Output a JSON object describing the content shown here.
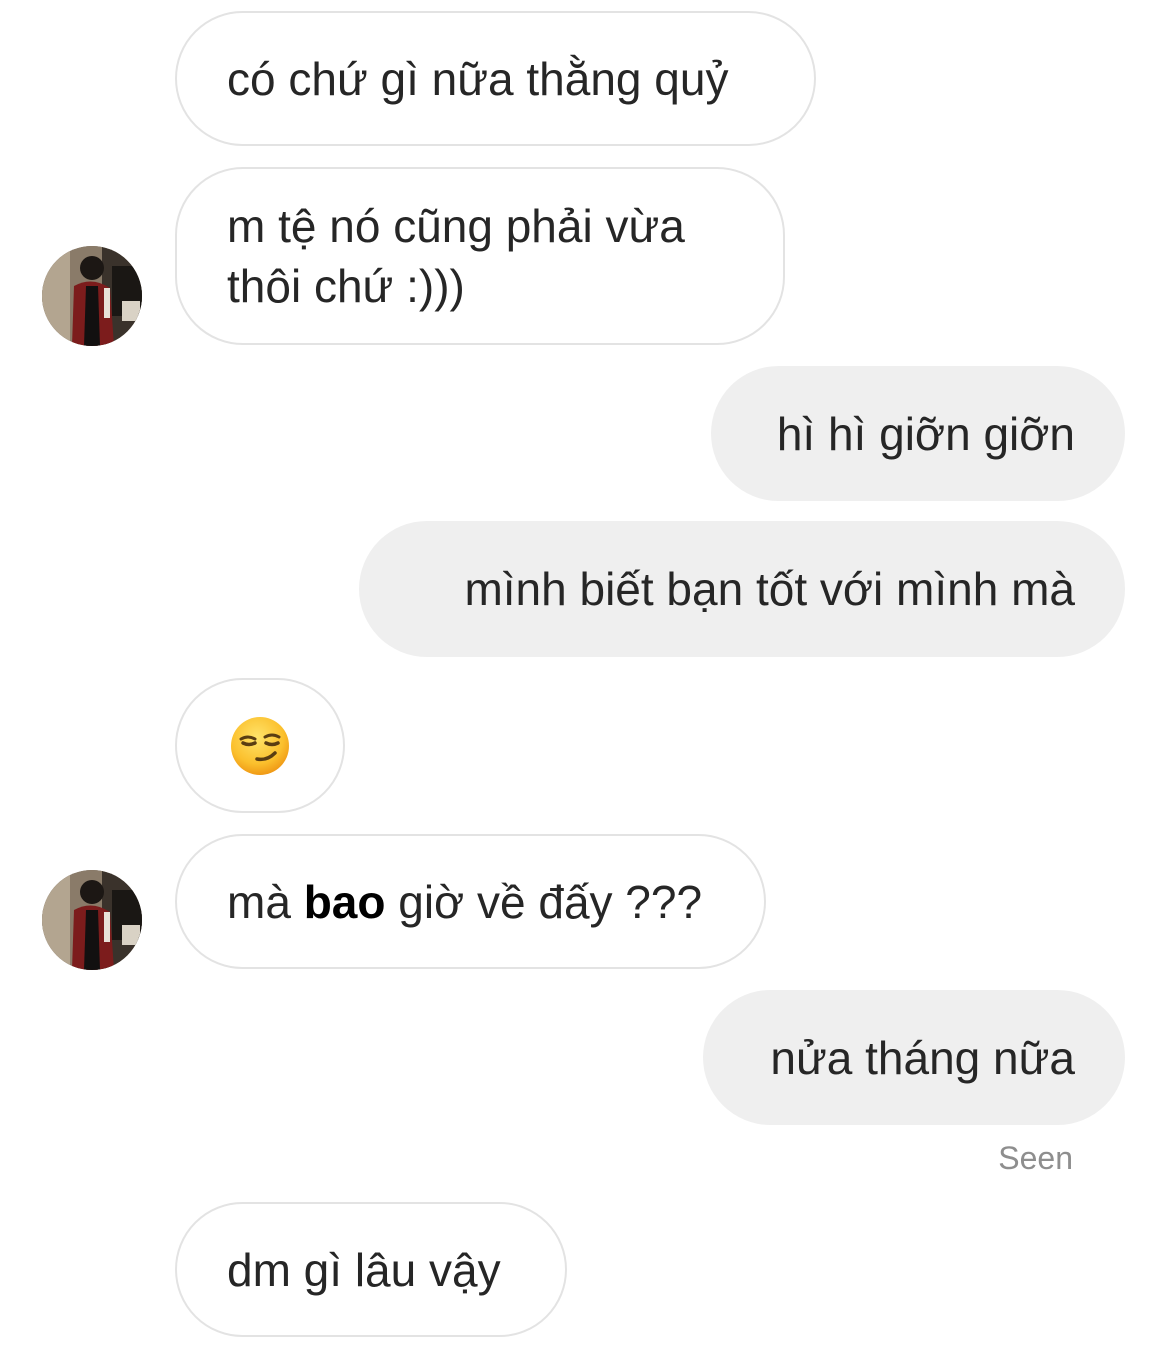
{
  "conversation": {
    "messages": [
      {
        "side": "in",
        "text": "có chứ gì nữa thằng quỷ"
      },
      {
        "side": "in",
        "text": "m tệ nó cũng phải vừa thôi chứ :)))"
      },
      {
        "side": "out",
        "text": "hì hì giỡn giỡn"
      },
      {
        "side": "out",
        "text": "mình biết bạn tốt với mình mà"
      },
      {
        "side": "in",
        "emoji": "smirking-face"
      },
      {
        "side": "in",
        "text_before": "mà ",
        "text_bold": "bao",
        "text_after": " giờ về đấy ???"
      },
      {
        "side": "out",
        "text": "nửa tháng nữa"
      },
      {
        "side": "in",
        "text": "dm gì lâu vậy"
      }
    ],
    "seen_label": "Seen"
  },
  "colors": {
    "incoming_bubble": "#ffffff",
    "incoming_border": "#e3e3e3",
    "outgoing_bubble": "#efefef",
    "text": "#262626",
    "seen_text": "#8e8e8e"
  }
}
